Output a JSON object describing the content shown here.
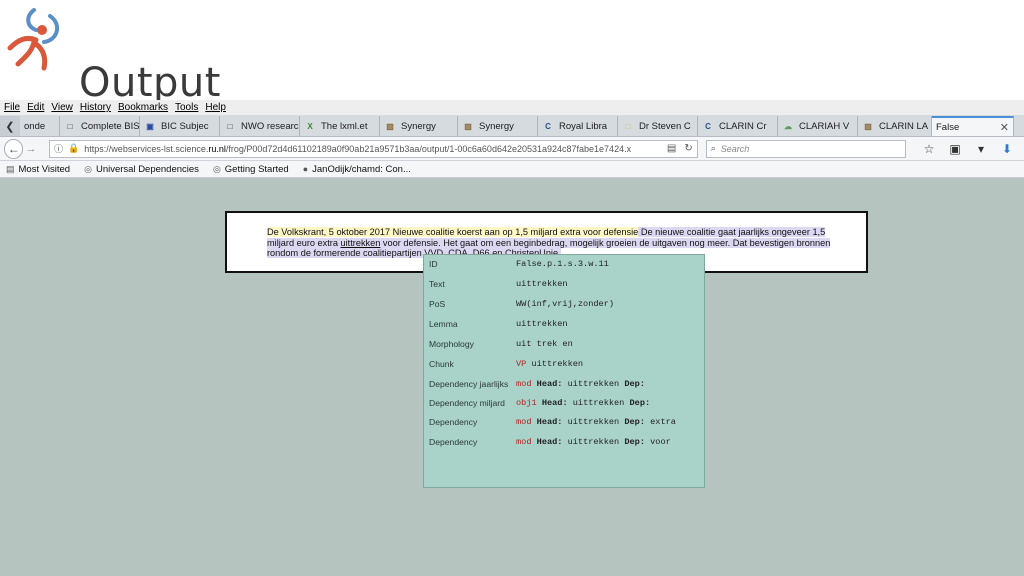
{
  "slide": {
    "title": "Output"
  },
  "menu": [
    "File",
    "Edit",
    "View",
    "History",
    "Bookmarks",
    "Tools",
    "Help"
  ],
  "tabs": [
    {
      "label": "onde",
      "icon": "page-icon",
      "color": "#888888"
    },
    {
      "label": "Complete BISA",
      "icon": "page-icon",
      "color": "#888888"
    },
    {
      "label": "BIC Subjec",
      "icon": "bic-icon",
      "color": "#2b4aa0"
    },
    {
      "label": "NWO research",
      "icon": "page-icon",
      "color": "#888888"
    },
    {
      "label": "The lxml.et",
      "icon": "lx-icon",
      "color": "#3a8a2a"
    },
    {
      "label": "Synergy",
      "icon": "synergy-icon",
      "color": "#8a6a3a"
    },
    {
      "label": "Synergy",
      "icon": "synergy-icon",
      "color": "#8a6a3a"
    },
    {
      "label": "Royal Libra",
      "icon": "c-icon",
      "color": "#1f4e8c"
    },
    {
      "label": "Dr Steven C",
      "icon": "page-icon",
      "color": "#e0c060"
    },
    {
      "label": "CLARIN Cr",
      "icon": "c-icon",
      "color": "#1f4e8c"
    },
    {
      "label": "CLARIAH V",
      "icon": "cloud-icon",
      "color": "#5aa05a"
    },
    {
      "label": "CLARIN LA",
      "icon": "synergy-icon",
      "color": "#8a6a3a"
    },
    {
      "label": "False",
      "icon": "",
      "color": "#ffffff",
      "active": true
    }
  ],
  "nav": {
    "url_prefix": "https://webservices-lst.science.",
    "url_domain": "ru.nl",
    "url_suffix": "/frog/P00d72d4d61102189a0f90ab21a9571b3aa/output/1-00c6a60d642e20531a924c87fabe1e7424.x",
    "search_placeholder": "Search"
  },
  "bookmarks": [
    {
      "label": "Most Visited",
      "icon": "bookmark-icon"
    },
    {
      "label": "Universal Dependencies",
      "icon": "globe-icon"
    },
    {
      "label": "Getting Started",
      "icon": "globe-icon"
    },
    {
      "label": "JanOdijk/chamd: Con...",
      "icon": "github-icon"
    }
  ],
  "sentence": {
    "part1": "De Volkskrant, 5 oktober 2017",
    "part2": " Nieuwe coalitie koerst aan op 1,5 miljard extra voor defensie",
    "part3": " De nieuwe coalitie gaat jaarlijks ongeveer 1,5 miljard euro extra ",
    "target": "uittrekken",
    "part4": " voor defensie. Het gaat om een beginbedrag, mogelijk groeien de uitgaven nog meer. Dat bevestigen bronnen rondom de formerende coalitiepartijen VVD, CDA, D66 en ChristenUnie."
  },
  "tooltip": {
    "rows": [
      {
        "key": "ID",
        "value": "False.p.1.s.3.w.11"
      },
      {
        "key": "Text",
        "value": "uittrekken"
      },
      {
        "key": "PoS",
        "value": "WW(inf,vrij,zonder)"
      },
      {
        "key": "Lemma",
        "value": "uittrekken"
      },
      {
        "key": "Morphology",
        "value": "uit trek en"
      },
      {
        "key": "Chunk",
        "rel": "VP",
        "rest": " uittrekken"
      },
      {
        "key": "Dependency jaarlijks",
        "rel": "mod",
        "head_label": "Head:",
        "head": " uittrekken ",
        "dep_label": "Dep:",
        "dep": ""
      },
      {
        "key": "Dependency miljard",
        "rel": "obj1",
        "head_label": "Head:",
        "head": " uittrekken ",
        "dep_label": "Dep:",
        "dep": ""
      },
      {
        "key": "Dependency",
        "rel": "mod",
        "head_label": "Head:",
        "head": " uittrekken ",
        "dep_label": "Dep:",
        "dep": " extra"
      },
      {
        "key": "Dependency",
        "rel": "mod",
        "head_label": "Head:",
        "head": " uittrekken ",
        "dep_label": "Dep:",
        "dep": " voor"
      }
    ]
  }
}
